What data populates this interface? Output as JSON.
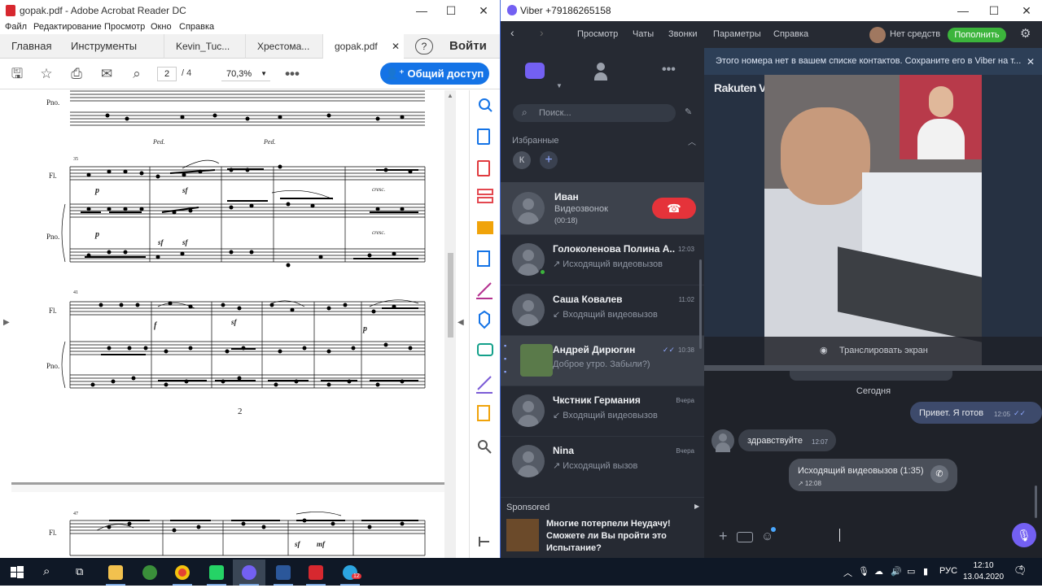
{
  "acrobat": {
    "window_title": "gopak.pdf - Adobe Acrobat Reader DC",
    "menu": [
      "Файл",
      "Редактирование",
      "Просмотр",
      "Окно",
      "Справка"
    ],
    "tabs": {
      "home": "Главная",
      "tools": "Инструменты",
      "doc1": "Kevin_Tuc...",
      "doc2": "Хрестома...",
      "doc3": "gopak.pdf",
      "signin": "Войти"
    },
    "toolbar": {
      "page_current": "2",
      "page_total": "/ 4",
      "zoom": "70,3%",
      "share_label": "Общий доступ"
    },
    "score": {
      "page_number": "2",
      "instruments": {
        "flute": "Fl.",
        "piano": "Pno."
      },
      "measure_numbers": [
        "35",
        "41",
        "47"
      ],
      "marks": {
        "ped": "Ped.",
        "cresc": "cresc.",
        "p": "p",
        "f": "f",
        "sf": "sf",
        "mf": "mf"
      }
    }
  },
  "viber": {
    "window_title": "Viber +79186265158",
    "nav": {
      "view": "Просмотр",
      "chats": "Чаты",
      "calls": "Звонки",
      "settings": "Параметры",
      "help": "Справка",
      "balance": "Нет средств",
      "topup": "Пополнить"
    },
    "search_placeholder": "Поиск...",
    "favorites_label": "Избранные",
    "favorite_initial": "К",
    "active_call": {
      "name": "Иван",
      "type": "Видеозвонок",
      "duration": "(00:18)"
    },
    "chats": [
      {
        "name": "Голоколенова Полина А...",
        "sub": "↗ Исходящий видеовызов",
        "time": "12:03"
      },
      {
        "name": "Саша Ковалев",
        "sub": "↙ Входящий видеовызов",
        "time": "11:02"
      },
      {
        "name": "Андрей Дирюгин",
        "sub": "Доброе утро. Забыли?)",
        "time": "10:38"
      },
      {
        "name": "Чкстник Германия",
        "sub": "↙ Входящий видеовызов",
        "time": "Вчера"
      },
      {
        "name": "Nina",
        "sub": "↗ Исходящий вызов",
        "time": "Вчера"
      }
    ],
    "sponsored": {
      "label": "Sponsored",
      "text": "Многие потерпели Неудачу! Сможете ли Вы пройти это Испытание?"
    },
    "notice": "Этого номера нет в вашем списке контактов. Сохраните его в Viber на т...",
    "brand": "Rakuten Viber",
    "share_screen": "Транслировать экран",
    "date_separator": "Сегодня",
    "messages": [
      {
        "text": "Привет. Я готов",
        "time": "12:05",
        "dir": "out"
      },
      {
        "text": "здравствуйте",
        "time": "12:07",
        "dir": "in"
      },
      {
        "text": "Исходящий видеовызов (1:35)",
        "time": "↗ 12:08",
        "dir": "call"
      }
    ]
  },
  "taskbar": {
    "lang": "РУС",
    "time": "12:10",
    "date": "13.04.2020",
    "telegram_badge": "12",
    "notif_count": "4"
  }
}
